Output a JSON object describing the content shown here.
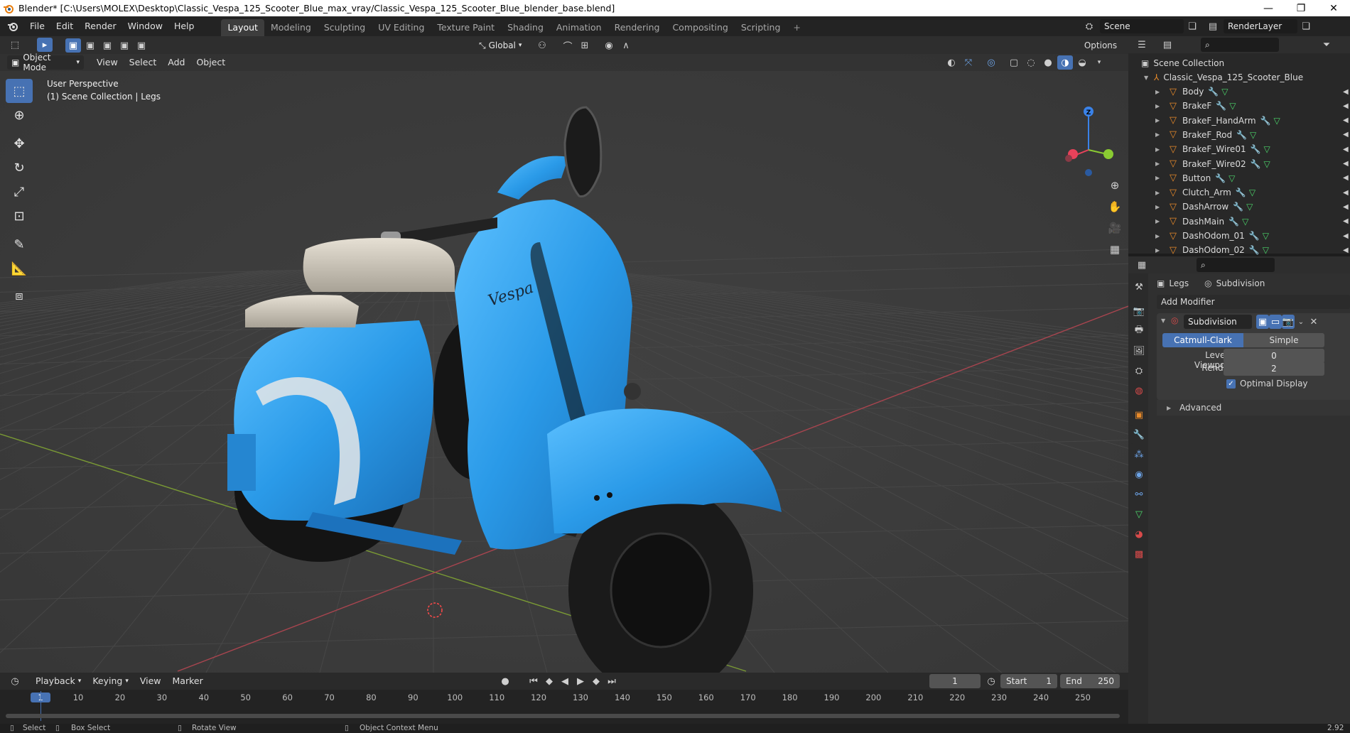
{
  "window": {
    "title": "Blender* [C:\\Users\\MOLEX\\Desktop\\Classic_Vespa_125_Scooter_Blue_max_vray/Classic_Vespa_125_Scooter_Blue_blender_base.blend]",
    "minimize": "—",
    "restore": "❐",
    "close": "✕"
  },
  "menu": [
    "File",
    "Edit",
    "Render",
    "Window",
    "Help"
  ],
  "workspaces": [
    "Layout",
    "Modeling",
    "Sculpting",
    "UV Editing",
    "Texture Paint",
    "Shading",
    "Animation",
    "Rendering",
    "Compositing",
    "Scripting"
  ],
  "workspace_add": "+",
  "scene": {
    "label": "Scene",
    "render_layer": "RenderLayer"
  },
  "viewport": {
    "mode": "Object Mode",
    "menus": [
      "View",
      "Select",
      "Add",
      "Object"
    ],
    "transform_orientation": "Global",
    "options_label": "Options",
    "overlay_line1": "User Perspective",
    "overlay_line2": "(1) Scene Collection | Legs",
    "gizmo_axis_z": "Z"
  },
  "outliner": {
    "root": "Scene Collection",
    "collection": "Classic_Vespa_125_Scooter_Blue",
    "items": [
      "Body",
      "BrakeF",
      "BrakeF_HandArm",
      "BrakeF_Rod",
      "BrakeF_Wire01",
      "BrakeF_Wire02",
      "Button",
      "Clutch_Arm",
      "DashArrow",
      "DashMain",
      "DashOdom_01",
      "DashOdom_02"
    ]
  },
  "properties": {
    "object": "Legs",
    "modifier_crumb": "Subdivision",
    "add_modifier": "Add Modifier",
    "modifier_name": "Subdivision",
    "mode_catmull": "Catmull-Clark",
    "mode_simple": "Simple",
    "levels_viewport_label": "Levels Viewport",
    "levels_viewport_value": "0",
    "render_label": "Render",
    "render_value": "2",
    "optimal_display": "Optimal Display",
    "advanced": "Advanced"
  },
  "timeline": {
    "menus": [
      "Playback",
      "Keying",
      "View",
      "Marker"
    ],
    "current_frame": "1",
    "start_label": "Start",
    "start_value": "1",
    "end_label": "End",
    "end_value": "250",
    "ticks": [
      "1",
      "10",
      "20",
      "30",
      "40",
      "50",
      "60",
      "70",
      "80",
      "90",
      "100",
      "110",
      "120",
      "130",
      "140",
      "150",
      "160",
      "170",
      "180",
      "190",
      "200",
      "210",
      "220",
      "230",
      "240",
      "250"
    ]
  },
  "status": {
    "select": "Select",
    "box_select": "Box Select",
    "rotate_view": "Rotate View",
    "context_menu": "Object Context Menu",
    "version": "2.92"
  },
  "colors": {
    "accent": "#4772b3",
    "scooter": "#2e9fe6",
    "grid": "#474747"
  }
}
